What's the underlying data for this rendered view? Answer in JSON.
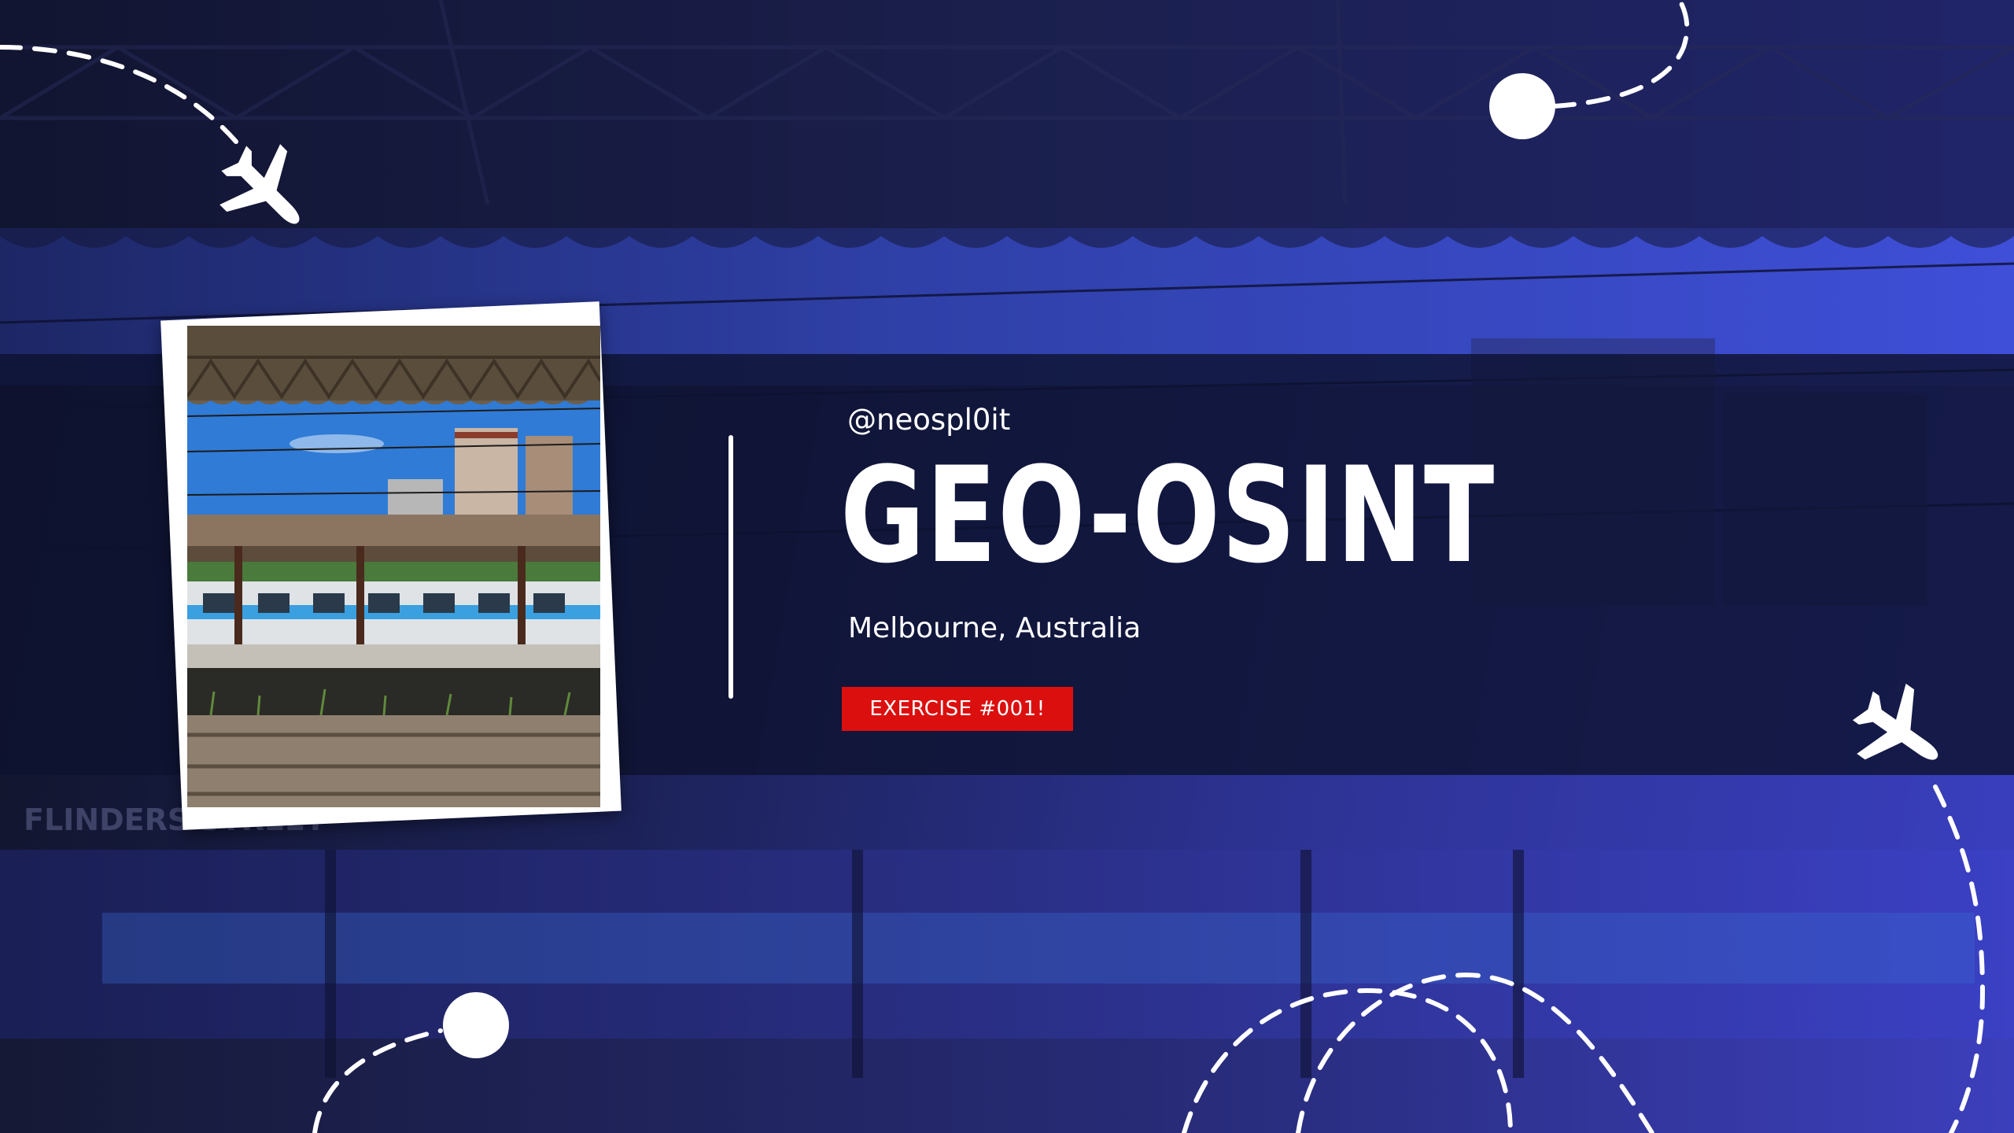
{
  "handle": "@neospl0it",
  "title": "GEO-OSINT",
  "location": "Melbourne, Australia",
  "badge_label": "EXERCISE #001!",
  "signage": {
    "platform_sign": "FLINDERS STREET"
  },
  "icons": [
    "airplane-icon",
    "airplane-icon",
    "dot-icon",
    "dot-icon"
  ],
  "colors": {
    "accent": "#dc0f0f",
    "band": "#0e1230",
    "gradient_right": "#3a3fc0",
    "text": "#ffffff"
  }
}
